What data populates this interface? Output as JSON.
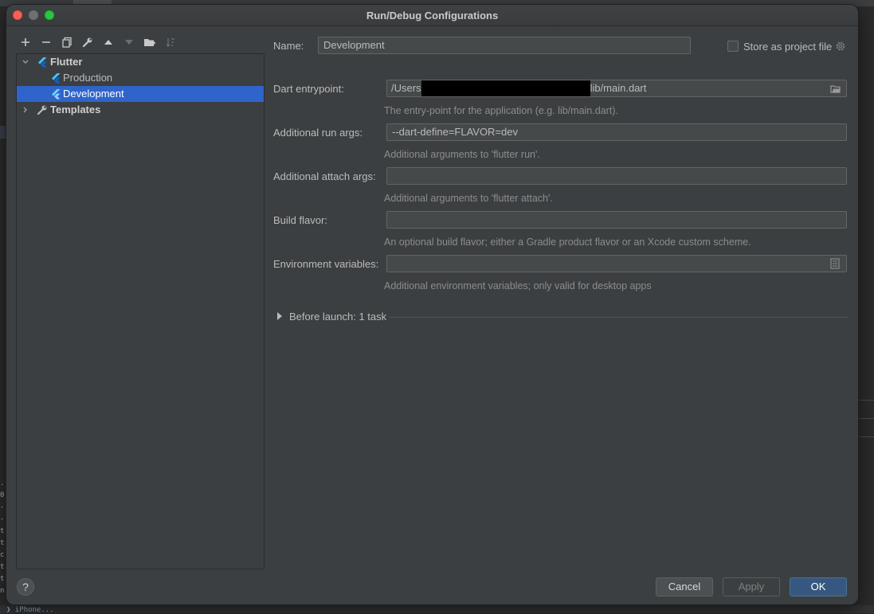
{
  "window": {
    "title": "Run/Debug Configurations"
  },
  "toolbar": {
    "icons": [
      "add-icon",
      "remove-icon",
      "copy-icon",
      "wrench-icon",
      "move-up-icon",
      "move-down-icon",
      "folder-icon",
      "sort-icon"
    ]
  },
  "tree": {
    "flutter_label": "Flutter",
    "production_label": "Production",
    "development_label": "Development",
    "templates_label": "Templates"
  },
  "form": {
    "name_label": "Name:",
    "name_value": "Development",
    "store_label": "Store as project file",
    "entrypoint_label": "Dart entrypoint:",
    "entrypoint_prefix": "/Users",
    "entrypoint_suffix": "lib/main.dart",
    "entrypoint_hint": "The entry-point for the application (e.g. lib/main.dart).",
    "run_args_label": "Additional run args:",
    "run_args_value": "--dart-define=FLAVOR=dev",
    "run_args_hint": "Additional arguments to 'flutter run'.",
    "attach_args_label": "Additional attach args:",
    "attach_args_value": "",
    "attach_args_hint": "Additional arguments to 'flutter attach'.",
    "build_flavor_label": "Build flavor:",
    "build_flavor_value": "",
    "build_flavor_hint": "An optional build flavor; either a Gradle product flavor or an Xcode custom scheme.",
    "env_label": "Environment variables:",
    "env_value": "",
    "env_hint": "Additional environment variables; only valid for desktop apps",
    "before_launch_label": "Before launch: 1 task"
  },
  "footer": {
    "help": "?",
    "cancel": "Cancel",
    "apply": "Apply",
    "ok": "OK"
  },
  "background": {
    "bottom_text": "❯ iPhone..."
  },
  "colors": {
    "dialog_bg": "#3c3f41",
    "selection": "#2f65ca",
    "ok_button": "#365880",
    "flutter_blue": "#47c5fb"
  }
}
